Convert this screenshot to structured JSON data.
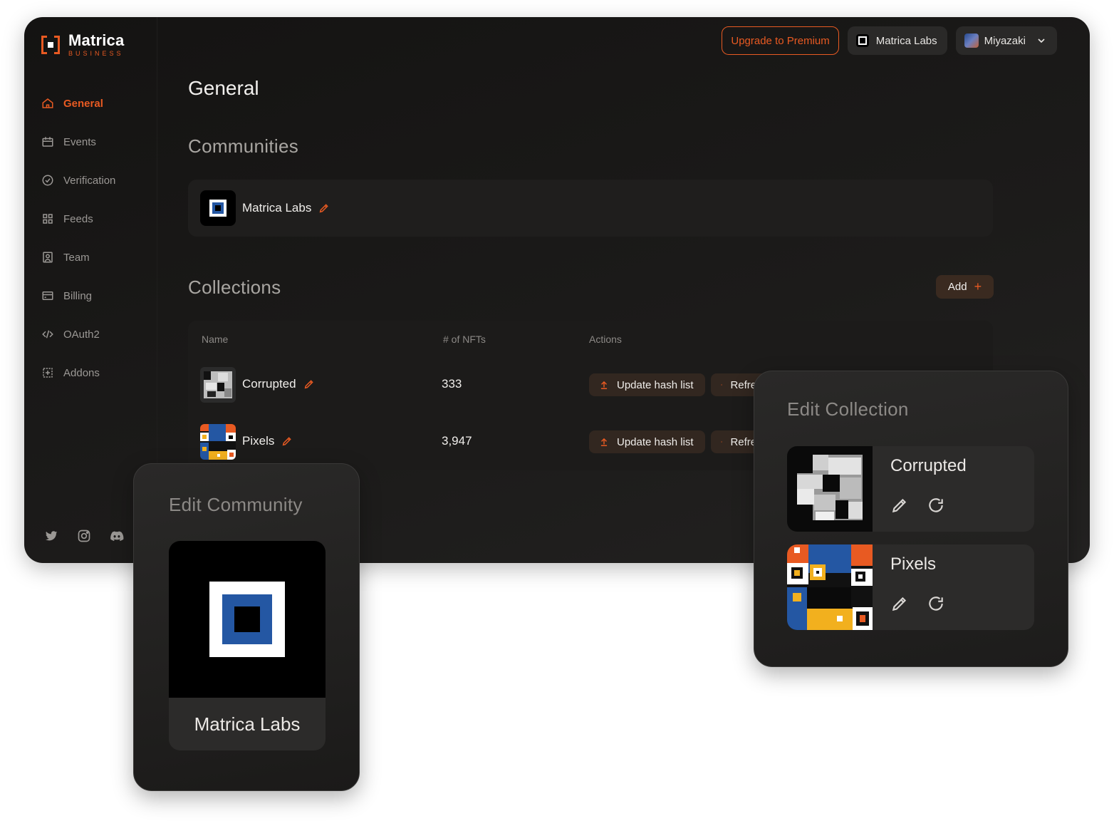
{
  "app": {
    "logo_name": "Matrica",
    "logo_sub": "BUSINESS"
  },
  "topbar": {
    "premium_label": "Upgrade to Premium",
    "org_label": "Matrica Labs",
    "user_label": "Miyazaki"
  },
  "sidebar": {
    "items": [
      {
        "label": "General",
        "icon": "home-icon",
        "active": true
      },
      {
        "label": "Events",
        "icon": "calendar-icon"
      },
      {
        "label": "Verification",
        "icon": "check-circle-icon"
      },
      {
        "label": "Feeds",
        "icon": "grid-icon"
      },
      {
        "label": "Team",
        "icon": "user-badge-icon"
      },
      {
        "label": "Billing",
        "icon": "card-icon"
      },
      {
        "label": "OAuth2",
        "icon": "code-icon"
      },
      {
        "label": "Addons",
        "icon": "addon-icon"
      }
    ],
    "social": [
      "twitter-icon",
      "instagram-icon",
      "discord-icon"
    ]
  },
  "main": {
    "page_title": "General",
    "communities_title": "Communities",
    "community_name": "Matrica Labs",
    "collections_title": "Collections",
    "add_label": "Add",
    "add_plus": "+",
    "table": {
      "headers": [
        "Name",
        "# of NFTs",
        "Actions"
      ],
      "rows": [
        {
          "name": "Corrupted",
          "count": "333",
          "update_label": "Update hash list",
          "refresh_label": "Refresh"
        },
        {
          "name": "Pixels",
          "count": "3,947",
          "update_label": "Update hash list",
          "refresh_label": "Refresh"
        }
      ]
    }
  },
  "edit_collection": {
    "title": "Edit Collection",
    "items": [
      {
        "name": "Corrupted"
      },
      {
        "name": "Pixels"
      }
    ]
  },
  "edit_community": {
    "title": "Edit Community",
    "name": "Matrica Labs"
  },
  "colors": {
    "accent": "#e85a22",
    "brand_blue": "#2457a3",
    "background": "#1a1918"
  }
}
